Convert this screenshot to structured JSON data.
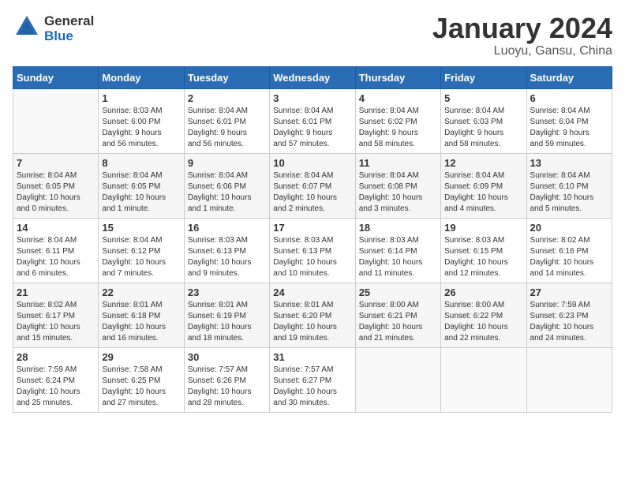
{
  "logo": {
    "text_general": "General",
    "text_blue": "Blue"
  },
  "title": {
    "month": "January 2024",
    "location": "Luoyu, Gansu, China"
  },
  "headers": [
    "Sunday",
    "Monday",
    "Tuesday",
    "Wednesday",
    "Thursday",
    "Friday",
    "Saturday"
  ],
  "weeks": [
    [
      {
        "day": "",
        "info": ""
      },
      {
        "day": "1",
        "info": "Sunrise: 8:03 AM\nSunset: 6:00 PM\nDaylight: 9 hours\nand 56 minutes."
      },
      {
        "day": "2",
        "info": "Sunrise: 8:04 AM\nSunset: 6:01 PM\nDaylight: 9 hours\nand 56 minutes."
      },
      {
        "day": "3",
        "info": "Sunrise: 8:04 AM\nSunset: 6:01 PM\nDaylight: 9 hours\nand 57 minutes."
      },
      {
        "day": "4",
        "info": "Sunrise: 8:04 AM\nSunset: 6:02 PM\nDaylight: 9 hours\nand 58 minutes."
      },
      {
        "day": "5",
        "info": "Sunrise: 8:04 AM\nSunset: 6:03 PM\nDaylight: 9 hours\nand 58 minutes."
      },
      {
        "day": "6",
        "info": "Sunrise: 8:04 AM\nSunset: 6:04 PM\nDaylight: 9 hours\nand 59 minutes."
      }
    ],
    [
      {
        "day": "7",
        "info": "Sunrise: 8:04 AM\nSunset: 6:05 PM\nDaylight: 10 hours\nand 0 minutes."
      },
      {
        "day": "8",
        "info": "Sunrise: 8:04 AM\nSunset: 6:05 PM\nDaylight: 10 hours\nand 1 minute."
      },
      {
        "day": "9",
        "info": "Sunrise: 8:04 AM\nSunset: 6:06 PM\nDaylight: 10 hours\nand 1 minute."
      },
      {
        "day": "10",
        "info": "Sunrise: 8:04 AM\nSunset: 6:07 PM\nDaylight: 10 hours\nand 2 minutes."
      },
      {
        "day": "11",
        "info": "Sunrise: 8:04 AM\nSunset: 6:08 PM\nDaylight: 10 hours\nand 3 minutes."
      },
      {
        "day": "12",
        "info": "Sunrise: 8:04 AM\nSunset: 6:09 PM\nDaylight: 10 hours\nand 4 minutes."
      },
      {
        "day": "13",
        "info": "Sunrise: 8:04 AM\nSunset: 6:10 PM\nDaylight: 10 hours\nand 5 minutes."
      }
    ],
    [
      {
        "day": "14",
        "info": "Sunrise: 8:04 AM\nSunset: 6:11 PM\nDaylight: 10 hours\nand 6 minutes."
      },
      {
        "day": "15",
        "info": "Sunrise: 8:04 AM\nSunset: 6:12 PM\nDaylight: 10 hours\nand 7 minutes."
      },
      {
        "day": "16",
        "info": "Sunrise: 8:03 AM\nSunset: 6:13 PM\nDaylight: 10 hours\nand 9 minutes."
      },
      {
        "day": "17",
        "info": "Sunrise: 8:03 AM\nSunset: 6:13 PM\nDaylight: 10 hours\nand 10 minutes."
      },
      {
        "day": "18",
        "info": "Sunrise: 8:03 AM\nSunset: 6:14 PM\nDaylight: 10 hours\nand 11 minutes."
      },
      {
        "day": "19",
        "info": "Sunrise: 8:03 AM\nSunset: 6:15 PM\nDaylight: 10 hours\nand 12 minutes."
      },
      {
        "day": "20",
        "info": "Sunrise: 8:02 AM\nSunset: 6:16 PM\nDaylight: 10 hours\nand 14 minutes."
      }
    ],
    [
      {
        "day": "21",
        "info": "Sunrise: 8:02 AM\nSunset: 6:17 PM\nDaylight: 10 hours\nand 15 minutes."
      },
      {
        "day": "22",
        "info": "Sunrise: 8:01 AM\nSunset: 6:18 PM\nDaylight: 10 hours\nand 16 minutes."
      },
      {
        "day": "23",
        "info": "Sunrise: 8:01 AM\nSunset: 6:19 PM\nDaylight: 10 hours\nand 18 minutes."
      },
      {
        "day": "24",
        "info": "Sunrise: 8:01 AM\nSunset: 6:20 PM\nDaylight: 10 hours\nand 19 minutes."
      },
      {
        "day": "25",
        "info": "Sunrise: 8:00 AM\nSunset: 6:21 PM\nDaylight: 10 hours\nand 21 minutes."
      },
      {
        "day": "26",
        "info": "Sunrise: 8:00 AM\nSunset: 6:22 PM\nDaylight: 10 hours\nand 22 minutes."
      },
      {
        "day": "27",
        "info": "Sunrise: 7:59 AM\nSunset: 6:23 PM\nDaylight: 10 hours\nand 24 minutes."
      }
    ],
    [
      {
        "day": "28",
        "info": "Sunrise: 7:59 AM\nSunset: 6:24 PM\nDaylight: 10 hours\nand 25 minutes."
      },
      {
        "day": "29",
        "info": "Sunrise: 7:58 AM\nSunset: 6:25 PM\nDaylight: 10 hours\nand 27 minutes."
      },
      {
        "day": "30",
        "info": "Sunrise: 7:57 AM\nSunset: 6:26 PM\nDaylight: 10 hours\nand 28 minutes."
      },
      {
        "day": "31",
        "info": "Sunrise: 7:57 AM\nSunset: 6:27 PM\nDaylight: 10 hours\nand 30 minutes."
      },
      {
        "day": "",
        "info": ""
      },
      {
        "day": "",
        "info": ""
      },
      {
        "day": "",
        "info": ""
      }
    ]
  ],
  "row_bg": [
    "#ffffff",
    "#f5f5f5",
    "#ffffff",
    "#f5f5f5",
    "#ffffff"
  ]
}
